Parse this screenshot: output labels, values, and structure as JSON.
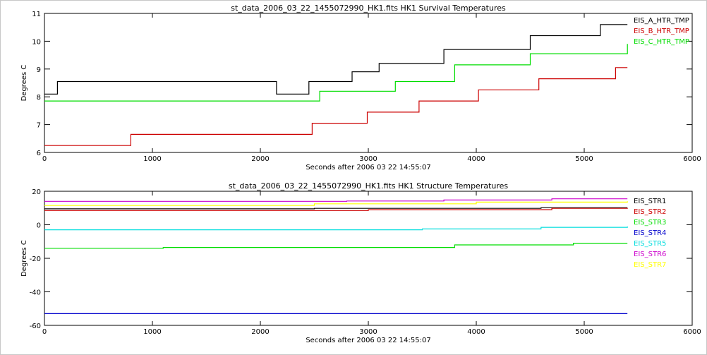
{
  "chart_data": [
    {
      "type": "line",
      "title": "st_data_2006_03_22_1455072990_HK1.fits HK1 Survival Temperatures",
      "xlabel": "Seconds after 2006 03 22 14:55:07",
      "ylabel": "Degrees C",
      "xlim": [
        0,
        6000
      ],
      "ylim": [
        6,
        11
      ],
      "xticks": [
        0,
        1000,
        2000,
        3000,
        4000,
        5000,
        6000
      ],
      "yticks": [
        6,
        7,
        8,
        9,
        10,
        11
      ],
      "legend_position": "top-right",
      "series": [
        {
          "name": "EIS_A_HTR_TMP",
          "color": "#000000",
          "x": [
            0,
            120,
            750,
            2050,
            2150,
            2450,
            2850,
            3100,
            3700,
            4500,
            5150,
            5400
          ],
          "y": [
            8.1,
            8.55,
            8.55,
            8.55,
            8.1,
            8.55,
            8.9,
            9.2,
            9.7,
            10.2,
            10.6,
            10.6
          ]
        },
        {
          "name": "EIS_B_HTR_TMP",
          "color": "#cc0000",
          "x": [
            0,
            750,
            800,
            1050,
            2450,
            2480,
            2950,
            2990,
            3450,
            3470,
            4000,
            4020,
            4550,
            4580,
            5250,
            5290,
            5400
          ],
          "y": [
            6.25,
            6.25,
            6.65,
            6.65,
            6.65,
            7.05,
            7.05,
            7.45,
            7.45,
            7.85,
            7.85,
            8.25,
            8.25,
            8.65,
            8.65,
            9.05,
            9.05
          ]
        },
        {
          "name": "EIS_C_HTR_TMP",
          "color": "#00dd00",
          "x": [
            0,
            850,
            2050,
            2150,
            2550,
            3250,
            3800,
            4500,
            5400
          ],
          "y": [
            7.85,
            7.85,
            7.85,
            7.85,
            8.2,
            8.55,
            9.15,
            9.55,
            9.9
          ]
        }
      ]
    },
    {
      "type": "line",
      "title": "st_data_2006_03_22_1455072990_HK1.fits HK1 Structure Temperatures",
      "xlabel": "Seconds after 2006 03 22 14:55:07",
      "ylabel": "Degrees C",
      "xlim": [
        0,
        6000
      ],
      "ylim": [
        -60,
        20
      ],
      "xticks": [
        0,
        1000,
        2000,
        3000,
        4000,
        5000,
        6000
      ],
      "yticks": [
        -60,
        -40,
        -20,
        0,
        20
      ],
      "legend_position": "top-right",
      "series": [
        {
          "name": "EIS_STR1",
          "color": "#000000",
          "x": [
            0,
            800,
            1600,
            2500,
            3500,
            4600,
            5400
          ],
          "y": [
            9.5,
            9.5,
            9.5,
            9.8,
            9.8,
            10.2,
            10.2
          ]
        },
        {
          "name": "EIS_STR2",
          "color": "#cc0000",
          "x": [
            0,
            1600,
            3000,
            4700,
            5400
          ],
          "y": [
            8.5,
            8.5,
            9.0,
            9.8,
            10.0
          ]
        },
        {
          "name": "EIS_STR3",
          "color": "#00dd00",
          "x": [
            0,
            850,
            1100,
            3800,
            4900,
            5400
          ],
          "y": [
            -14,
            -14,
            -13.5,
            -12,
            -11,
            -11
          ]
        },
        {
          "name": "EIS_STR4",
          "color": "#0000cc",
          "x": [
            0,
            5400
          ],
          "y": [
            -53,
            -53
          ]
        },
        {
          "name": "EIS_STR5",
          "color": "#00dddd",
          "x": [
            0,
            2150,
            3500,
            4600,
            5400
          ],
          "y": [
            -3,
            -3,
            -2.5,
            -1.5,
            -1
          ]
        },
        {
          "name": "EIS_STR6",
          "color": "#cc00cc",
          "x": [
            0,
            1500,
            2800,
            3700,
            4700,
            5400
          ],
          "y": [
            14,
            14,
            14.2,
            14.8,
            15.5,
            15.5
          ]
        },
        {
          "name": "EIS_STR7",
          "color": "#ffff00",
          "x": [
            0,
            1000,
            2500,
            4000,
            5400
          ],
          "y": [
            11.5,
            11.5,
            12.5,
            13.5,
            14
          ]
        }
      ]
    }
  ]
}
